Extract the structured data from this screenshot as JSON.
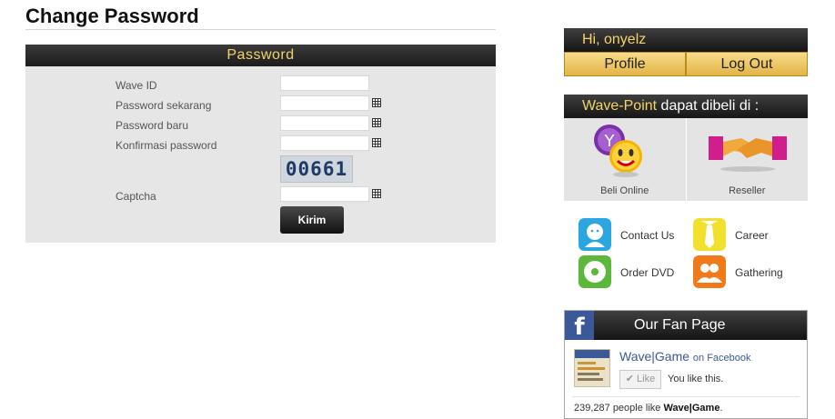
{
  "page": {
    "title": "Change Password"
  },
  "form": {
    "header": "Password",
    "fields": [
      {
        "label": "Wave ID",
        "value": ""
      },
      {
        "label": "Password sekarang",
        "value": ""
      },
      {
        "label": "Password baru",
        "value": ""
      },
      {
        "label": "Konfirmasi password",
        "value": ""
      }
    ],
    "captcha": {
      "label": "Captcha",
      "image_text": "00661",
      "value": ""
    },
    "submit_label": "Kirim"
  },
  "sidebar": {
    "user": {
      "greeting": "Hi, onyelz",
      "profile_label": "Profile",
      "logout_label": "Log Out"
    },
    "buy": {
      "brand": "Wave-Point",
      "header_rest": " dapat dibeli di :",
      "online_label": "Beli  Online",
      "reseller_label": "Reseller"
    },
    "links": [
      {
        "label": "Contact Us",
        "icon": "contact-icon"
      },
      {
        "label": "Career",
        "icon": "career-tie-icon"
      },
      {
        "label": "Order DVD",
        "icon": "dvd-icon"
      },
      {
        "label": "Gathering",
        "icon": "gathering-icon"
      }
    ],
    "fanpage": {
      "title": "Our Fan Page",
      "page_name": "Wave|Game",
      "on_facebook": "on Facebook",
      "like_label": "Like",
      "like_status": "You like this.",
      "count_prefix": "239,287 people like ",
      "count_page": "Wave|Game",
      "count_suffix": "."
    }
  },
  "colors": {
    "accent_gold": "#f3d36a",
    "header_dark": "#1c1c1c",
    "facebook_blue": "#3b5998",
    "panel_gray": "#e6e6e6"
  }
}
